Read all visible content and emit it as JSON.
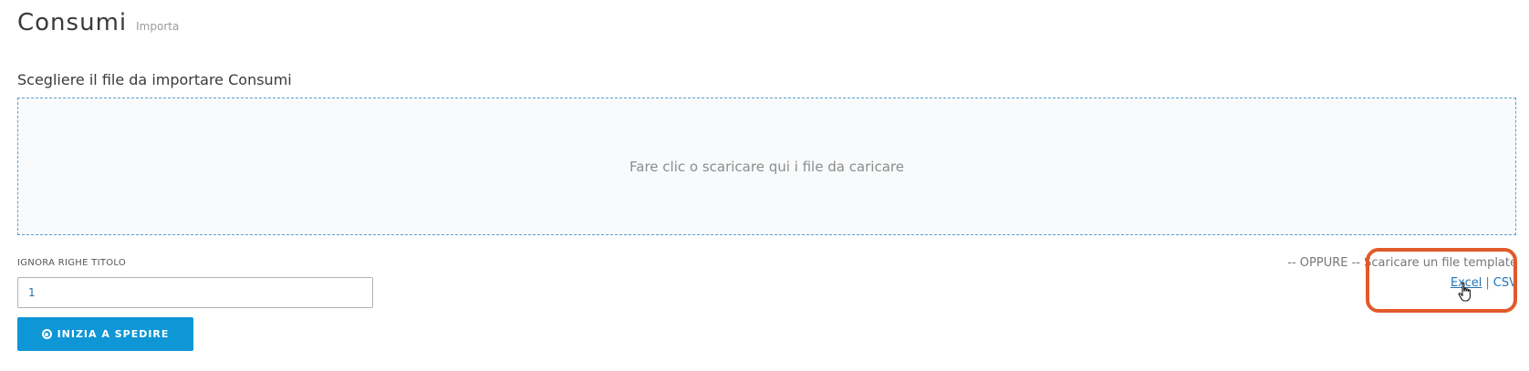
{
  "header": {
    "title": "Consumi",
    "subtitle": "Importa"
  },
  "upload": {
    "section_title": "Scegliere il file da importare Consumi",
    "dropzone_text": "Fare clic o scaricare qui i file da caricare"
  },
  "form": {
    "ignore_rows_label": "IGNORA RIGHE TITOLO",
    "ignore_rows_value": "1",
    "start_button_label": "INIZIA A SPEDIRE",
    "start_button_icon": "circle-dot-icon"
  },
  "template": {
    "prefix": "-- OPPURE --",
    "text": "Scaricare un file template",
    "excel_label": "Excel",
    "separator": "|",
    "csv_label": "CSV"
  },
  "colors": {
    "primary": "#0f96d6",
    "link": "#1f73b7",
    "highlight": "#e05a2a",
    "dropzone_border": "#5a9fd1"
  }
}
